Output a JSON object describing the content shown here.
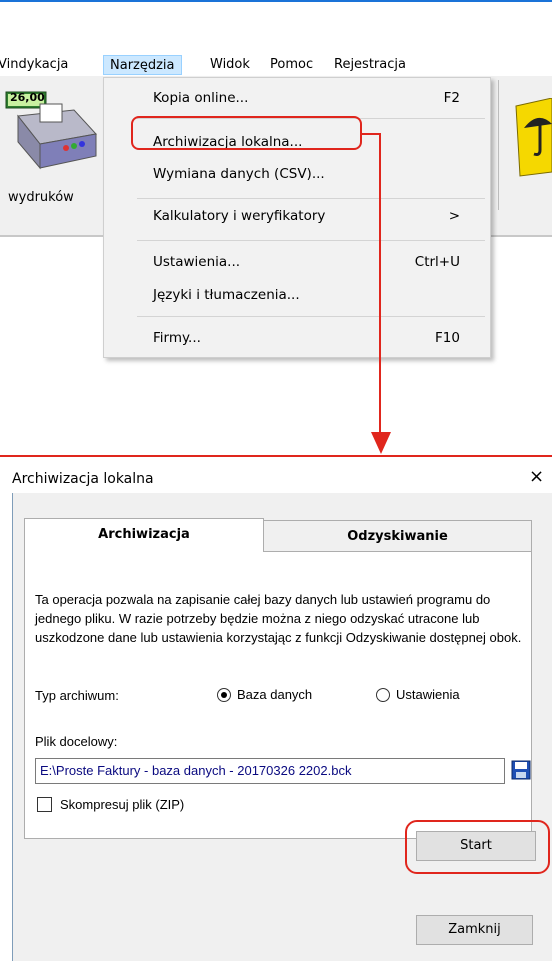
{
  "menubar": {
    "items": [
      {
        "label": "Vindykacja"
      },
      {
        "label": "Narzędzia"
      },
      {
        "label": "Widok"
      },
      {
        "label": "Pomoc"
      },
      {
        "label": "Rejestracja"
      }
    ]
  },
  "toolbar": {
    "printer_amount": "26,00",
    "label": "wydruków"
  },
  "dropdown": {
    "items": [
      {
        "label": "Kopia online...",
        "shortcut": "F2"
      },
      {
        "label": "Archiwizacja lokalna...",
        "shortcut": ""
      },
      {
        "label": "Wymiana danych (CSV)...",
        "shortcut": ""
      },
      {
        "label": "Kalkulatory i weryfikatory",
        "shortcut": ">"
      },
      {
        "label": "Ustawienia...",
        "shortcut": "Ctrl+U"
      },
      {
        "label": "Języki i tłumaczenia...",
        "shortcut": ""
      },
      {
        "label": "Firmy...",
        "shortcut": "F10"
      }
    ]
  },
  "dialog": {
    "title": "Archiwizacja lokalna",
    "close": "×",
    "tabs": [
      {
        "label": "Archiwizacja"
      },
      {
        "label": "Odzyskiwanie"
      }
    ],
    "description": "Ta operacja pozwala na zapisanie całej bazy danych lub ustawień programu do jednego pliku. W razie potrzeby będzie można z niego odzyskać utracone lub uszkodzone dane lub ustawienia korzystając z funkcji Odzyskiwanie dostępnej obok.",
    "archive_type_label": "Typ archiwum:",
    "radio_options": [
      {
        "label": "Baza danych",
        "checked": true
      },
      {
        "label": "Ustawienia",
        "checked": false
      }
    ],
    "target_label": "Plik docelowy:",
    "target_value": "E:\\Proste Faktury - baza danych - 20170326 2202.bck",
    "compress_label": "Skompresuj plik (ZIP)",
    "compress_checked": false,
    "start_label": "Start",
    "close_label": "Zamknij"
  },
  "colors": {
    "highlight": "#e0261d",
    "menu_active": "#cce8ff"
  }
}
